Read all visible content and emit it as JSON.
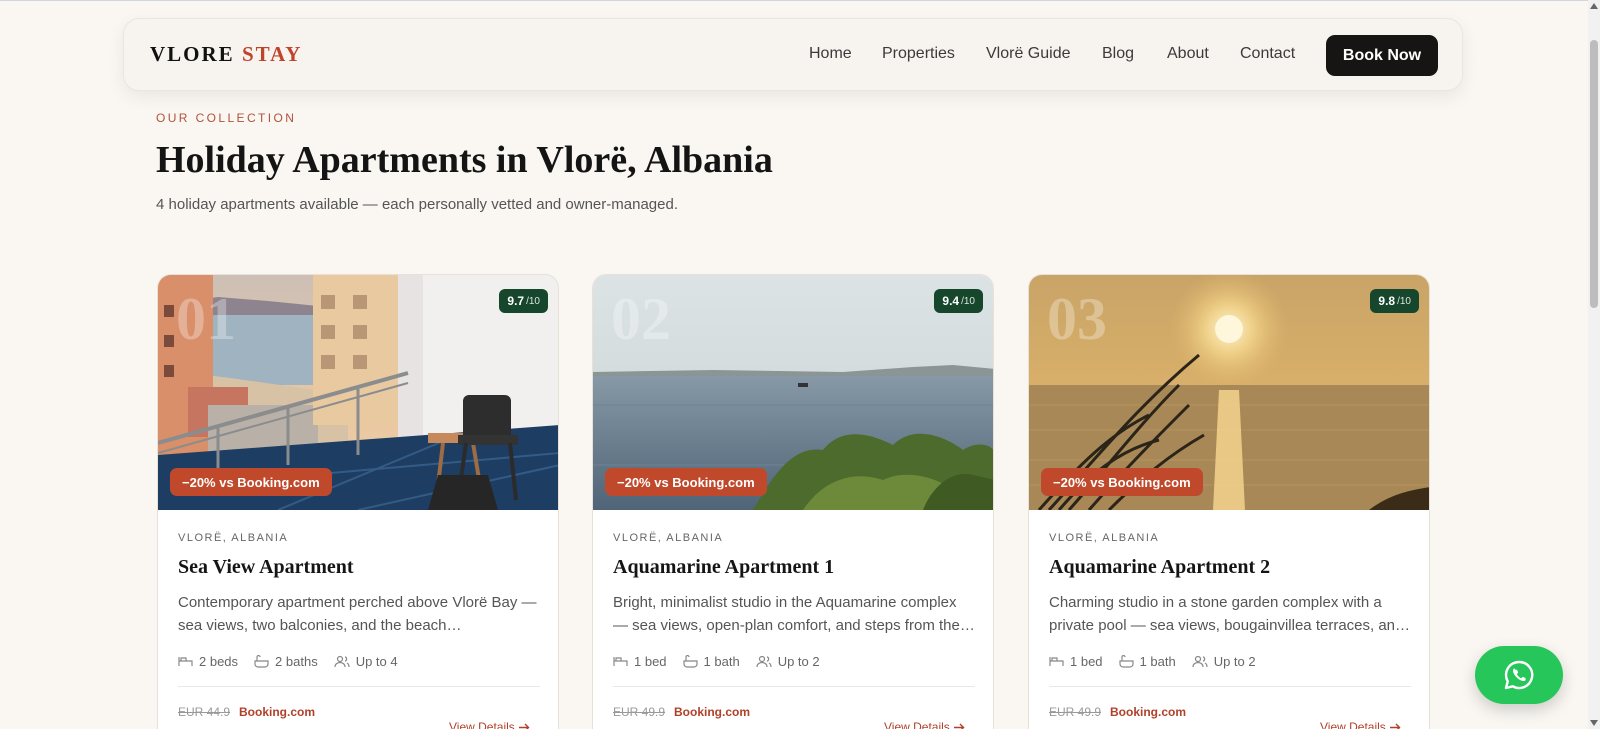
{
  "nav": {
    "brand_primary": "VLORE",
    "brand_accent": "STAY",
    "links": [
      "Home",
      "Properties",
      "Vlorë Guide",
      "Blog",
      "About",
      "Contact"
    ],
    "cta": "Book Now"
  },
  "hero": {
    "eyebrow": "OUR COLLECTION",
    "title": "Holiday Apartments in Vlorë, Albania",
    "subtitle": "4 holiday apartments available — each personally vetted and owner-managed."
  },
  "cards": [
    {
      "number": "01",
      "rating": "9.7",
      "rating_scale": "/10",
      "discount": "−20% vs Booking.com",
      "location": "VLORË, ALBANIA",
      "title": "Sea View Apartment",
      "description": "Contemporary apartment perched above Vlorë Bay — sea views, two balconies, and the beach promenade…",
      "beds": "2 beds",
      "baths": "2 baths",
      "guests": "Up to 4",
      "old_price": "EUR 44.9",
      "price_source": "Booking.com",
      "details_label": "View Details"
    },
    {
      "number": "02",
      "rating": "9.4",
      "rating_scale": "/10",
      "discount": "−20% vs Booking.com",
      "location": "VLORË, ALBANIA",
      "title": "Aquamarine Apartment 1",
      "description": "Bright, minimalist studio in the Aquamarine complex — sea views, open-plan comfort, and steps from the…",
      "beds": "1 bed",
      "baths": "1 bath",
      "guests": "Up to 2",
      "old_price": "EUR 49.9",
      "price_source": "Booking.com",
      "details_label": "View Details"
    },
    {
      "number": "03",
      "rating": "9.8",
      "rating_scale": "/10",
      "discount": "−20% vs Booking.com",
      "location": "VLORË, ALBANIA",
      "title": "Aquamarine Apartment 2",
      "description": "Charming studio in a stone garden complex with a private pool — sea views, bougainvillea terraces, an…",
      "beds": "1 bed",
      "baths": "1 bath",
      "guests": "Up to 2",
      "old_price": "EUR 49.9",
      "price_source": "Booking.com",
      "details_label": "View Details"
    }
  ],
  "icons": {
    "bed": "bed-icon",
    "bath": "bath-icon",
    "guests": "users-icon",
    "arrow": "arrow-right-icon",
    "whatsapp": "whatsapp-icon"
  },
  "colors": {
    "accent": "#c0442b",
    "rating_bg": "#16462c",
    "discount_bg": "#c0492c",
    "whatsapp": "#27c65b",
    "cta_bg": "#171513"
  }
}
